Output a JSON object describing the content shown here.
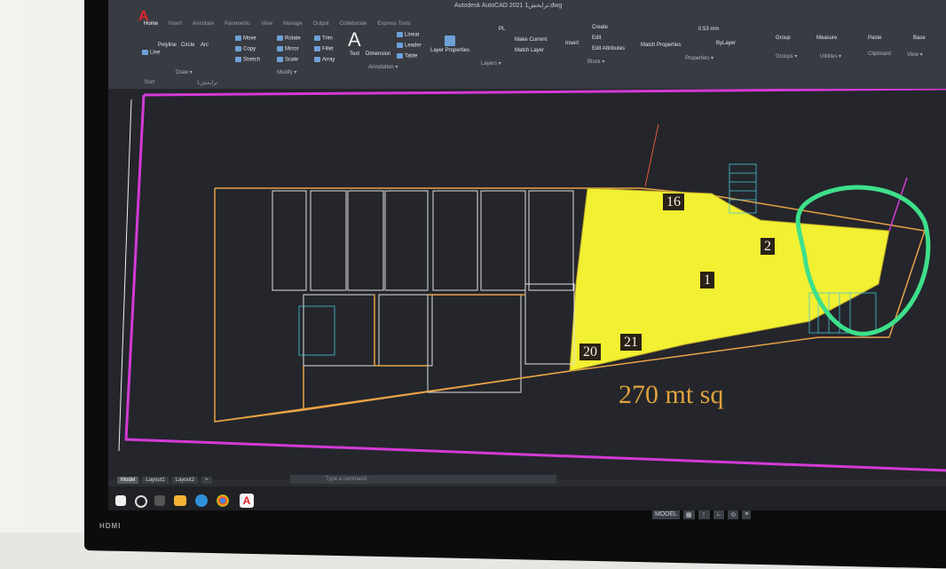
{
  "app": {
    "title": "Autodesk AutoCAD 2021  ترايحش1.dwg",
    "logo": "A"
  },
  "ribbon": {
    "tabs": [
      "Home",
      "Insert",
      "Annotate",
      "Parametric",
      "View",
      "Manage",
      "Output",
      "Collaborate",
      "Express Tools"
    ],
    "active_tab": "Home",
    "draw": {
      "line": "Line",
      "polyline": "Polyline",
      "circle": "Circle",
      "arc": "Arc",
      "label": "Draw ▾"
    },
    "modify": {
      "move": "Move",
      "rotate": "Rotate",
      "trim": "Trim",
      "copy": "Copy",
      "mirror": "Mirror",
      "fillet": "Fillet",
      "stretch": "Stretch",
      "scale": "Scale",
      "array": "Array",
      "label": "Modify ▾"
    },
    "annotation": {
      "text": "Text",
      "dimension": "Dimension",
      "linear": "Linear",
      "leader": "Leader",
      "table": "Table",
      "label": "Annotation ▾"
    },
    "layers": {
      "layer_properties": "Layer Properties",
      "make_current": "Make Current",
      "match_layer": "Match Layer",
      "current_layer": "PL",
      "label": "Layers ▾"
    },
    "block": {
      "insert": "Insert",
      "create": "Create",
      "edit": "Edit",
      "edit_attributes": "Edit Attributes",
      "label": "Block ▾"
    },
    "properties": {
      "match": "Match Properties",
      "by_layer": "ByLayer",
      "lineweight": "0.53 mm",
      "label": "Properties ▾"
    },
    "groups": {
      "group": "Group",
      "label": "Groups ▾"
    },
    "utilities": {
      "measure": "Measure",
      "label": "Utilities ▾"
    },
    "clipboard": {
      "paste": "Paste",
      "label": "Clipboard"
    },
    "view": {
      "base": "Base",
      "label": "View ▾"
    }
  },
  "tab_strip": {
    "start": "Start",
    "file": "ترايحش1"
  },
  "drawing": {
    "area_label": "270 mt sq",
    "unit_numbers": [
      "16",
      "2",
      "1",
      "20",
      "21"
    ],
    "highlight_color": "#f2f032",
    "circle_color": "#3ee08a",
    "frame_color": "#d43ad6",
    "wall_color": "#e8a245"
  },
  "command": {
    "placeholder": "Type a command"
  },
  "layouts": [
    "Model",
    "Layout1",
    "Layout2",
    "+"
  ],
  "status_bar": {
    "model": "MODEL"
  },
  "bezel": {
    "brand": "HDMI"
  }
}
